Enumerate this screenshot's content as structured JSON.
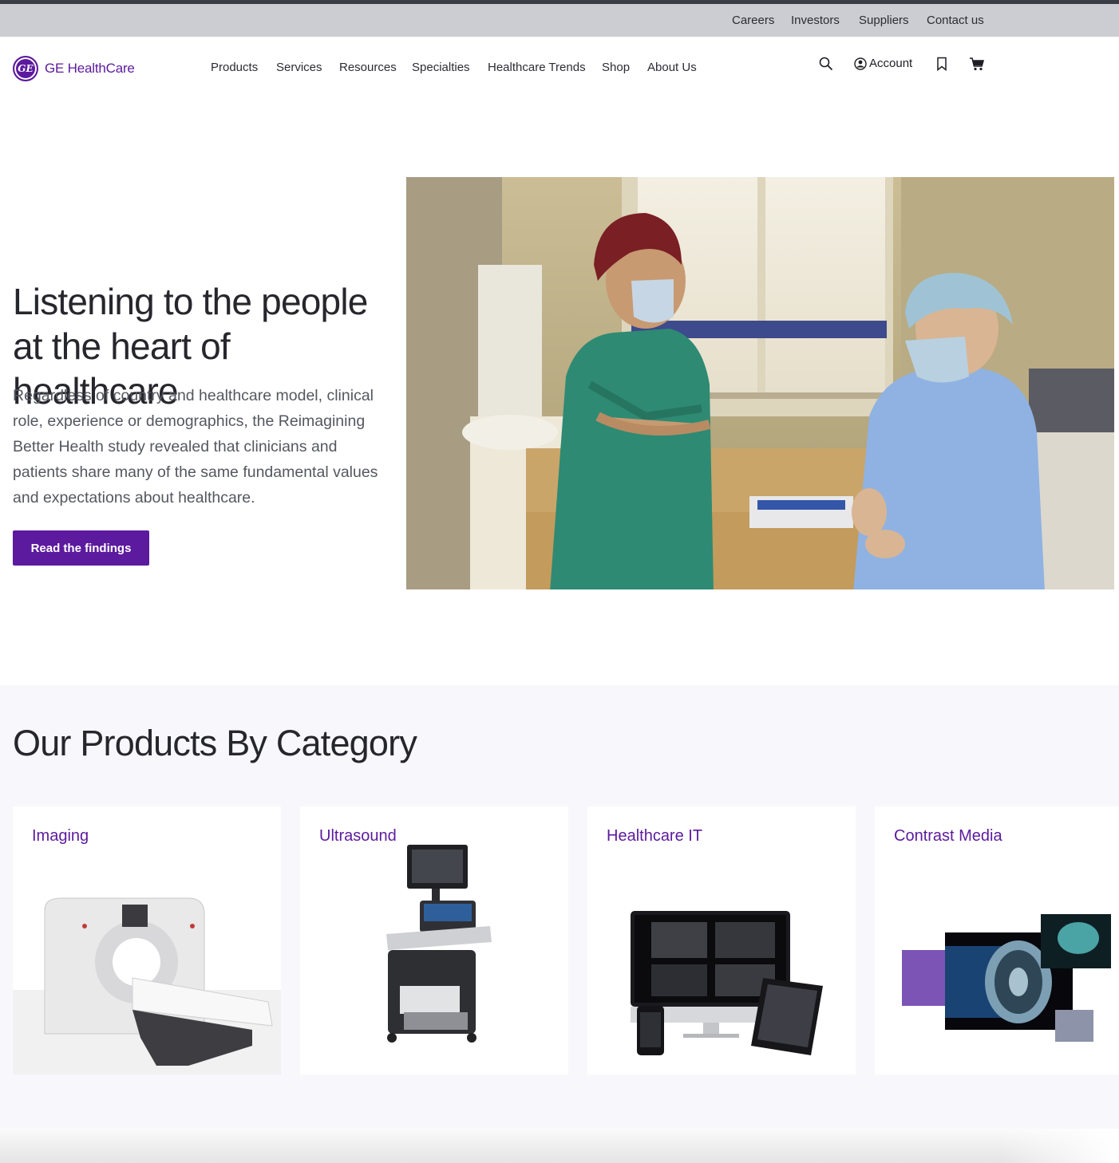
{
  "utility_nav": [
    "Careers",
    "Investors",
    "Suppliers",
    "Contact us"
  ],
  "brand": {
    "name": "GE HealthCare",
    "mark": "GE",
    "color": "#5c1a9e"
  },
  "main_nav": [
    "Products",
    "Services",
    "Resources",
    "Specialties",
    "Healthcare Trends",
    "Shop",
    "About Us"
  ],
  "header_actions": {
    "search_icon": "search-icon",
    "account_label": "Account",
    "account_icon": "user-circle-icon",
    "bookmark_icon": "bookmark-icon",
    "cart_icon": "cart-icon"
  },
  "hero": {
    "title": "Listening to the people at the heart of healthcare",
    "body": "Regardless of country and healthcare model, clinical role, experience or demographics, the Reimagining Better Health study revealed that clinicians and patients share many of the same fundamental values and expectations about healthcare.",
    "cta": "Read the findings"
  },
  "products": {
    "title": "Our Products By Category",
    "categories": [
      "Imaging",
      "Ultrasound",
      "Healthcare IT",
      "Contrast Media"
    ]
  },
  "colors": {
    "accent": "#5c1a9e",
    "utility_bar": "#cbcdd2",
    "section_bg": "#f8f7fc"
  }
}
